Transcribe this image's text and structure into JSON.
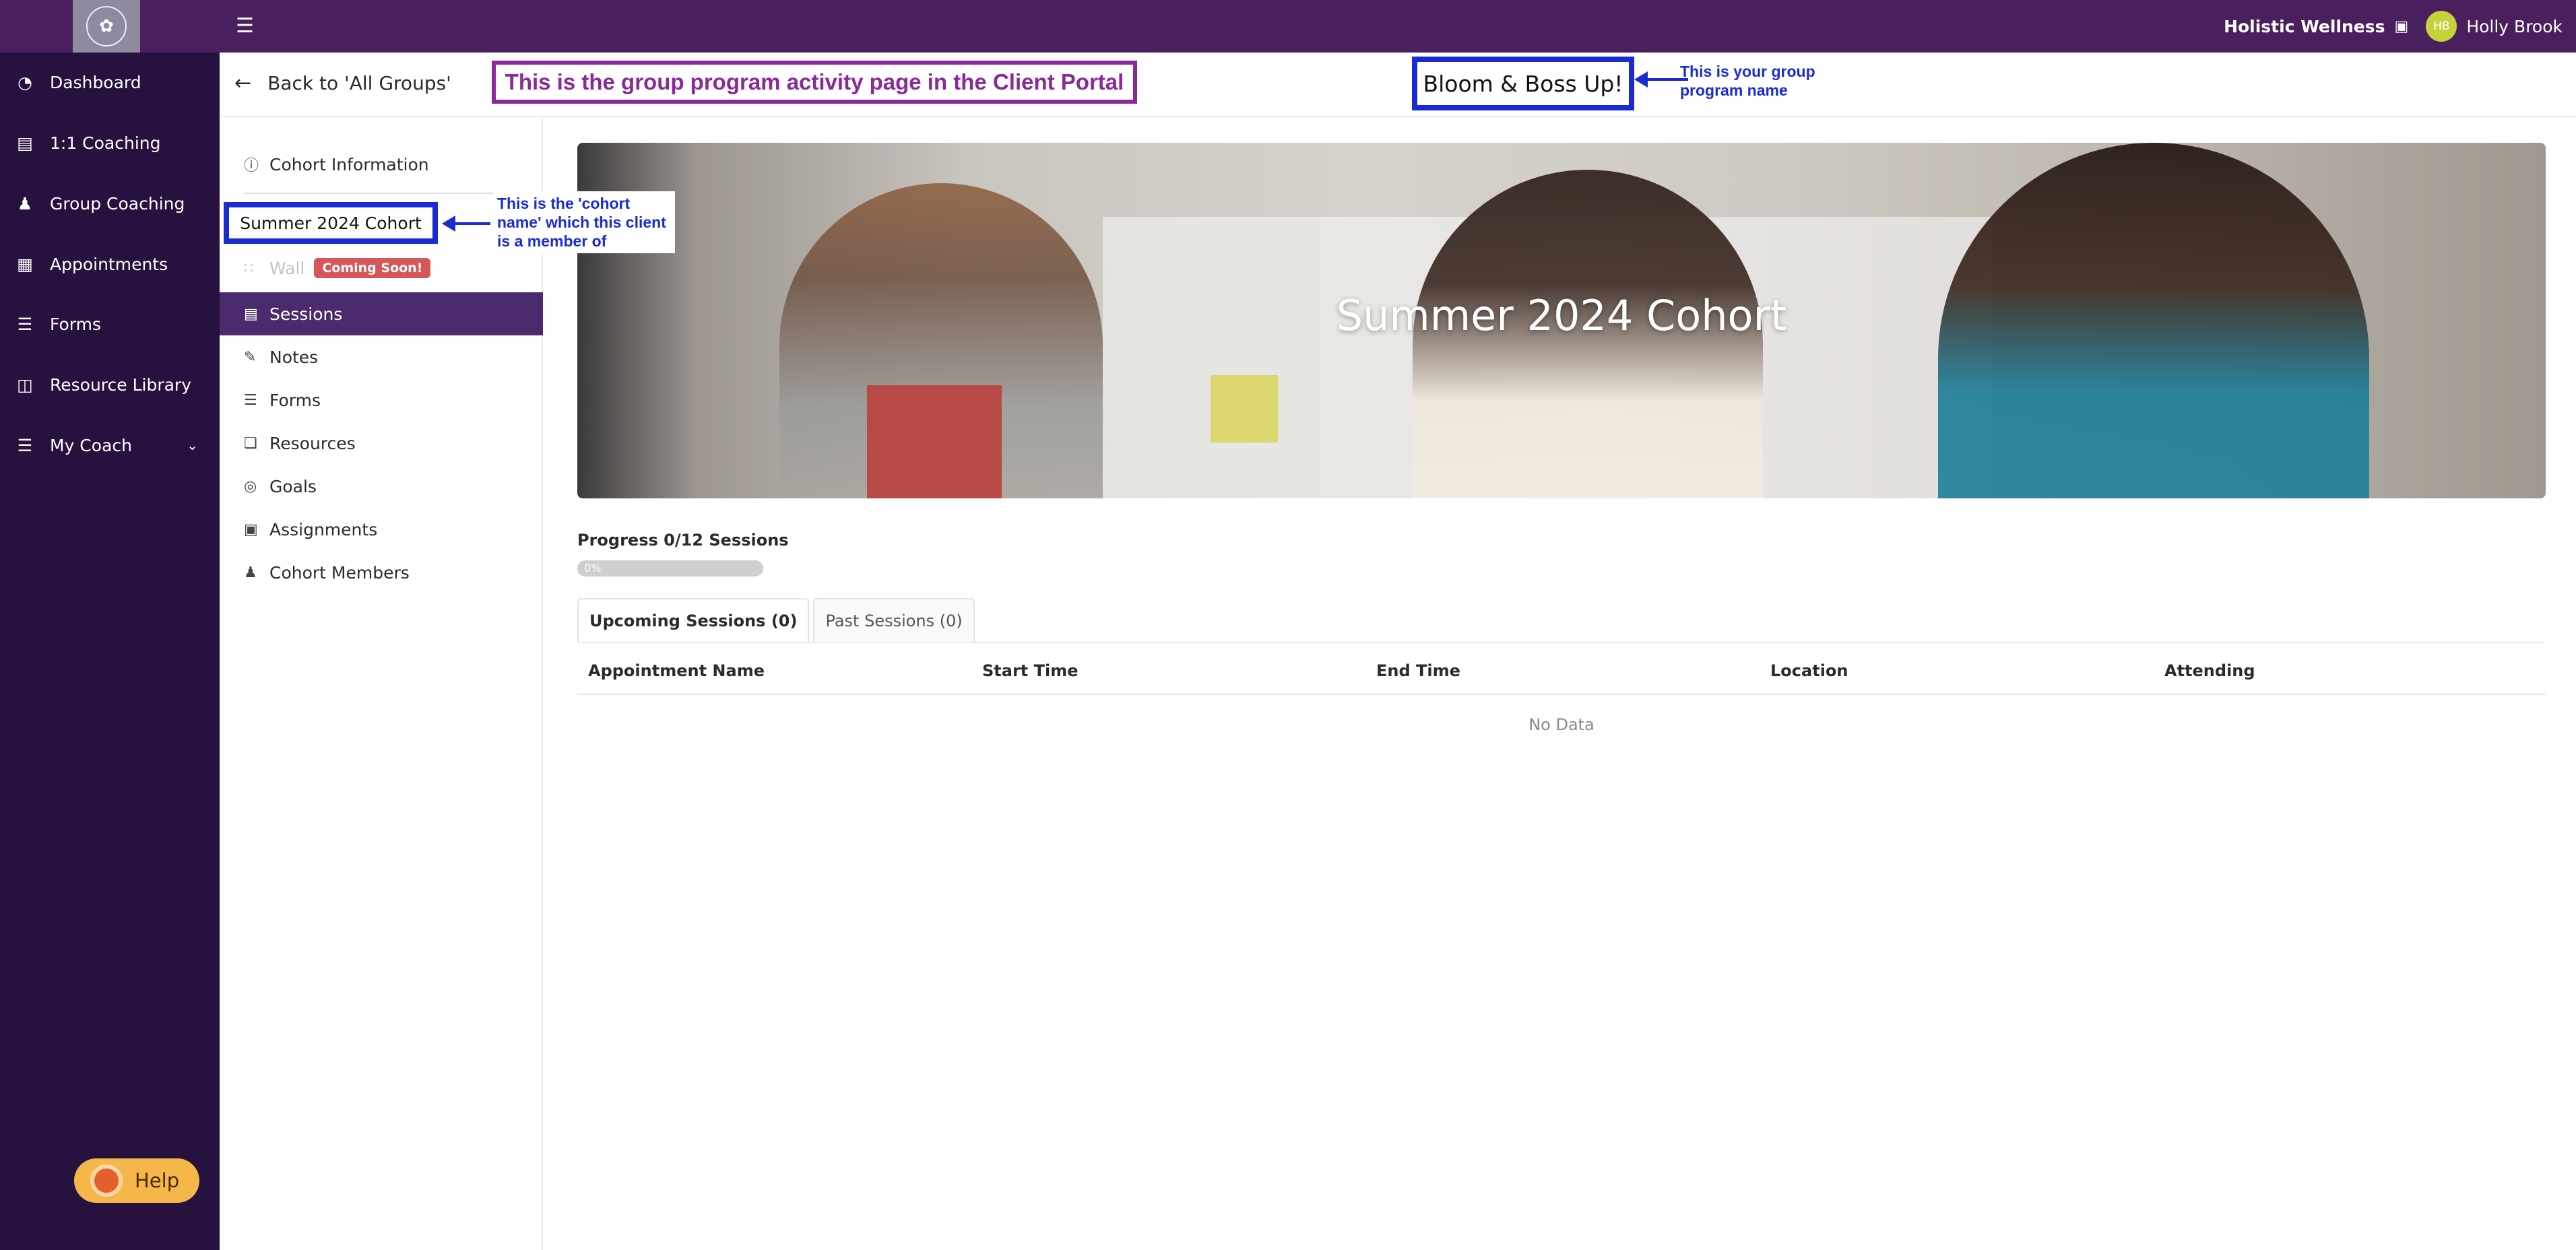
{
  "topbar": {
    "org_name": "Holistic Wellness",
    "user_initials": "HB",
    "user_name": "Holly Brook"
  },
  "sidebar": {
    "items": [
      {
        "label": "Dashboard",
        "icon": "dashboard-icon"
      },
      {
        "label": "1:1 Coaching",
        "icon": "book-icon"
      },
      {
        "label": "Group Coaching",
        "icon": "group-icon"
      },
      {
        "label": "Appointments",
        "icon": "calendar-icon"
      },
      {
        "label": "Forms",
        "icon": "list-icon"
      },
      {
        "label": "Resource Library",
        "icon": "library-icon"
      },
      {
        "label": "My Coach",
        "icon": "coach-icon"
      }
    ],
    "help_label": "Help"
  },
  "header": {
    "back_label": "Back to 'All Groups'",
    "annotation_title": "This is the group program activity page in the Client Portal",
    "program_name": "Bloom & Boss Up!",
    "program_note": "This is your group program name"
  },
  "sub_sidebar": {
    "cohort_info_label": "Cohort Information",
    "cohort_name": "Summer 2024 Cohort",
    "cohort_note": "This is the 'cohort name' which this client is a member of",
    "wall_label": "Wall",
    "coming_soon_badge": "Coming Soon!",
    "items": [
      {
        "label": "Sessions",
        "icon": "sessions-icon",
        "active": true
      },
      {
        "label": "Notes",
        "icon": "notes-icon"
      },
      {
        "label": "Forms",
        "icon": "forms-icon"
      },
      {
        "label": "Resources",
        "icon": "resources-icon"
      },
      {
        "label": "Goals",
        "icon": "goals-icon"
      },
      {
        "label": "Assignments",
        "icon": "assignments-icon"
      },
      {
        "label": "Cohort Members",
        "icon": "members-icon"
      }
    ]
  },
  "banner": {
    "title": "Summer 2024 Cohort"
  },
  "progress": {
    "label": "Progress 0/12 Sessions",
    "percent_text": "0%",
    "completed": 0,
    "total": 12
  },
  "tabs": [
    {
      "label": "Upcoming Sessions (0)",
      "active": true
    },
    {
      "label": "Past Sessions (0)",
      "active": false
    }
  ],
  "table": {
    "columns": [
      "Appointment Name",
      "Start Time",
      "End Time",
      "Location",
      "Attending"
    ],
    "empty_text": "No Data"
  },
  "colors": {
    "topbar": "#4a1f5e",
    "sidebar": "#27113e",
    "active_item": "#4b2a6e",
    "annotation_blue": "#1a2bd4",
    "annotation_purple": "#8a2a9a"
  }
}
